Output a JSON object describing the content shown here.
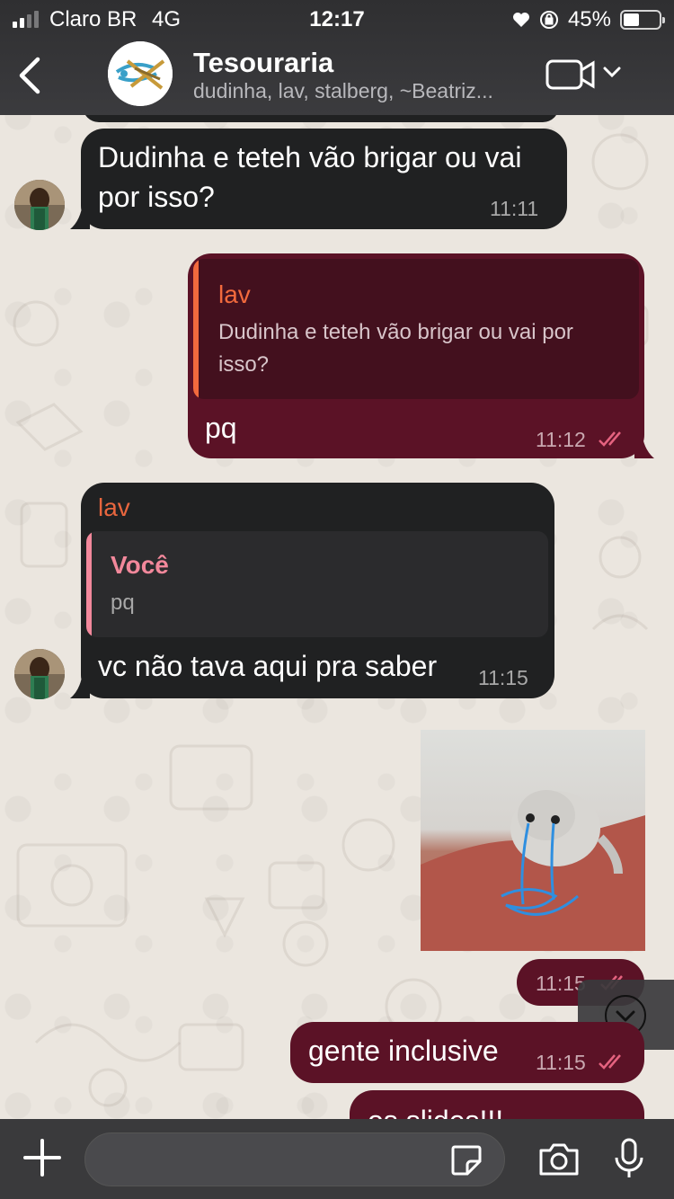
{
  "status_bar": {
    "carrier": "Claro BR",
    "network": "4G",
    "time": "12:17",
    "battery": "45%",
    "battery_level": 0.45
  },
  "header": {
    "group_name": "Tesouraria",
    "members": "dudinha, lav, stalberg, ~Beatriz..."
  },
  "messages": [
    {
      "type": "incoming",
      "text": "Dudinha e teteh vão brigar ou vai por isso?",
      "text_line1": "Dudinha e teteh vão brigar ou vai",
      "text_line2": "por isso?",
      "time": "11:11"
    },
    {
      "type": "outgoing",
      "quote_author": "lav",
      "quote_line1": "Dudinha e teteh vão brigar ou vai por",
      "quote_line2": "isso?",
      "text": "pq",
      "time": "11:12"
    },
    {
      "type": "incoming",
      "sender": "lav",
      "quote_author": "Você",
      "quote_text": "pq",
      "text": "vc não tava aqui pra saber",
      "time": "11:15"
    },
    {
      "type": "outgoing-image",
      "time": "11:15"
    },
    {
      "type": "outgoing",
      "text": "gente inclusive",
      "time": "11:15"
    },
    {
      "type": "outgoing",
      "text": "os slides!!!"
    }
  ],
  "input": {
    "placeholder": ""
  },
  "colors": {
    "outgoing_bubble": "#5b1226",
    "incoming_bubble": "#202122",
    "sender_name": "#e8663e",
    "quote_you": "#f2889b",
    "header_bg": "#3a3a3c"
  },
  "icons": [
    "back-chevron-icon",
    "video-call-icon",
    "chevron-down-icon",
    "double-check-icon",
    "scroll-down-icon",
    "plus-icon",
    "sticker-icon",
    "camera-icon",
    "microphone-icon"
  ]
}
